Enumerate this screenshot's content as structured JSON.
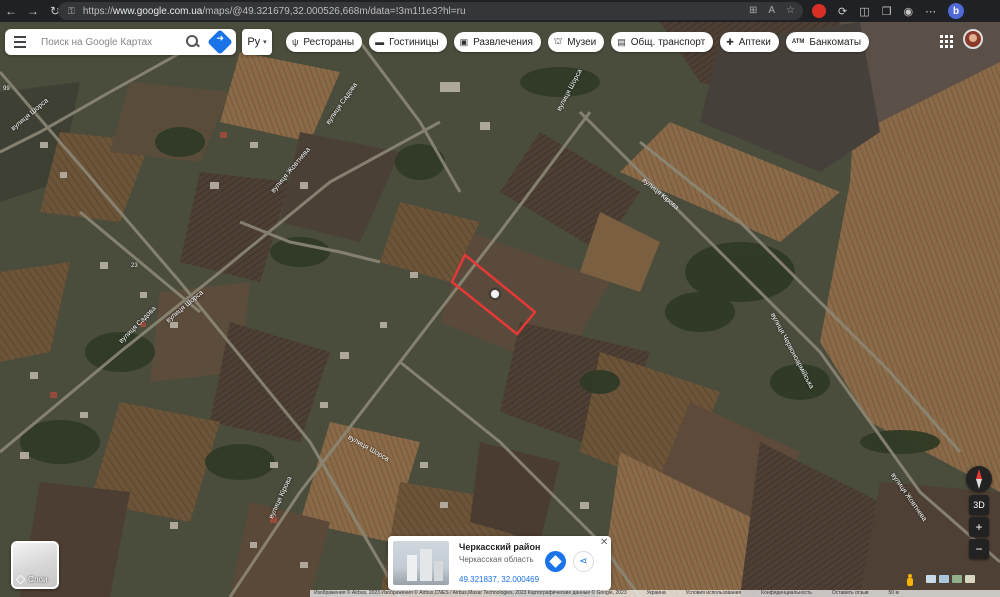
{
  "browser": {
    "url_prefix": "https://",
    "url_domain": "www.google.com.ua",
    "url_path": "/maps/@49.321679,32.000526,668m/data=!3m1!1e3?hl=ru",
    "back_icon": "back-arrow-icon",
    "forward_icon": "forward-arrow-icon",
    "reload_icon": "reload-icon"
  },
  "search": {
    "placeholder": "Поиск на Google Картах"
  },
  "language": {
    "value": "Ру"
  },
  "categories": [
    {
      "label": "Рестораны",
      "icon": "ψ"
    },
    {
      "label": "Гостиницы",
      "icon": "▬"
    },
    {
      "label": "Развлечения",
      "icon": "▣"
    },
    {
      "label": "Музеи",
      "icon": "⛫"
    },
    {
      "label": "Общ. транспорт",
      "icon": "▤"
    },
    {
      "label": "Аптеки",
      "icon": "✚"
    },
    {
      "label": "Банкоматы",
      "icon": "ATM"
    }
  ],
  "layers": {
    "label": "Слои"
  },
  "place_card": {
    "title": "Черкасский район",
    "subtitle": "Черкасская область",
    "coordinates": "49.321837, 32.000469"
  },
  "controls": {
    "tilt": "3D",
    "zoom_in": "+",
    "zoom_out": "−"
  },
  "map": {
    "streets": {
      "s1": "вулиця Шорса",
      "s2": "вулиця Садова",
      "s3": "вулиця Садова",
      "s4": "вулиця Шорса",
      "s5": "вулиця Жовтнева",
      "s6": "вулиця Кірова",
      "s7": "вулиця Червоноармійська",
      "s8": "вулиця Шорса",
      "s9": "вулиця Кірова",
      "s10": "вулиця Жовтнева",
      "s11": "вулиця Шорса"
    },
    "road_numbers": {
      "r1": "23",
      "r2": "99"
    },
    "highlight_color": "#e53935"
  },
  "footer": {
    "imagery": "Изображения © Airbus, 2023 Изображения © Airbus,CNES / Airbus,Maxar Technologies, 2023 Картографические данные © Google, 2023",
    "country": "Украина",
    "terms": "Условия использования",
    "privacy": "Конфиденциальность",
    "feedback": "Оставить отзыв",
    "scale": "50 м"
  }
}
